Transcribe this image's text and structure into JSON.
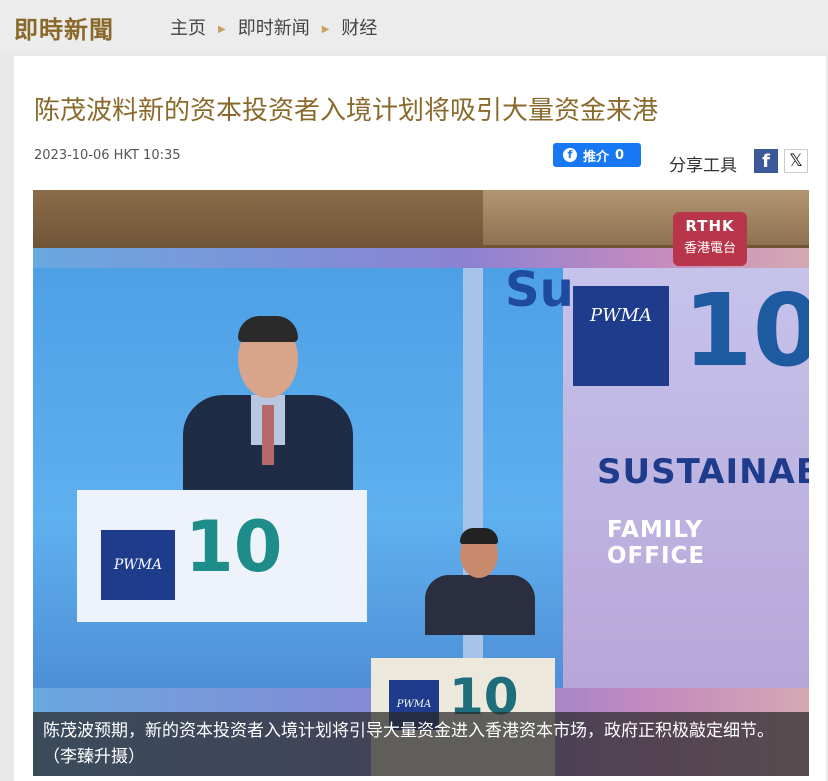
{
  "site": {
    "logo": "即時新聞"
  },
  "breadcrumb": [
    "主页",
    "即时新闻",
    "财经"
  ],
  "article": {
    "title": "陈茂波料新的资本投资者入境计划将吸引大量资金来港",
    "timestamp": "2023-10-06 HKT 10:35",
    "like_label": "推介",
    "like_count": "0",
    "share_label": "分享工具"
  },
  "photo": {
    "caption": "陈茂波预期，新的资本投资者入境计划将引导大量资金进入香港资本市场，政府正积极敲定细节。（李臻升摄）",
    "rthk_logo_en": "RTHK",
    "rthk_logo_zh": "香港電台",
    "backdrop_text_su": "Su",
    "backdrop_text_sustain": "SUSTAINAB",
    "backdrop_text_family": "FAMILY OFFICE",
    "pwma_label": "PWMA",
    "ten_label": "10"
  },
  "icons": [
    "facebook-icon",
    "x-icon",
    "chevron-right-icon"
  ]
}
